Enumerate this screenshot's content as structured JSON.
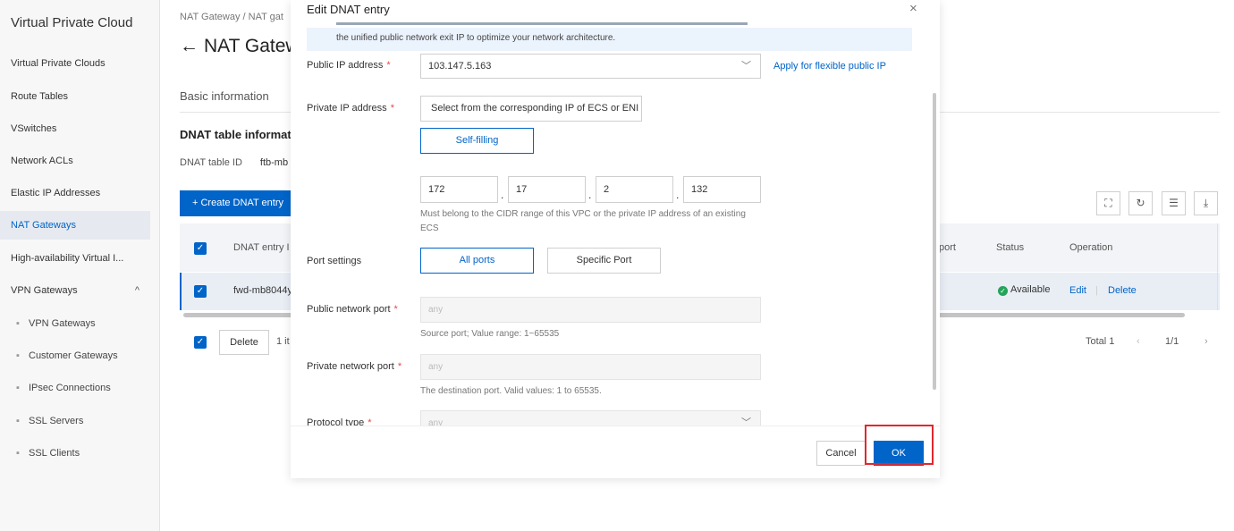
{
  "sidebar": {
    "title": "Virtual Private Cloud",
    "items": [
      {
        "label": "Virtual Private Clouds",
        "active": false
      },
      {
        "label": "Route Tables",
        "active": false
      },
      {
        "label": "VSwitches",
        "active": false
      },
      {
        "label": "Network ACLs",
        "active": false
      },
      {
        "label": "Elastic IP Addresses",
        "active": false
      },
      {
        "label": "NAT Gateways",
        "active": true
      },
      {
        "label": "High-availability Virtual I...",
        "active": false
      },
      {
        "label": "VPN Gateways",
        "active": false,
        "expanded": true
      }
    ],
    "sub_items": [
      {
        "label": "VPN Gateways"
      },
      {
        "label": "Customer Gateways"
      },
      {
        "label": "IPsec Connections"
      },
      {
        "label": "SSL Servers"
      },
      {
        "label": "SSL Clients"
      }
    ],
    "sub_bullet": "▪",
    "expand_glyph": "^"
  },
  "page": {
    "breadcrumb": "NAT Gateway  /  NAT gat",
    "title_arrow": "←",
    "title": "NAT Gatew",
    "tab_basic": "Basic information",
    "section_title": "DNAT table informat",
    "dnat_table_id_label": "DNAT table ID",
    "dnat_table_id_value": "ftb-mb",
    "create_button": "+ Create DNAT entry",
    "tools": [
      {
        "icon": "fullscreen-icon",
        "glyph": "⛶"
      },
      {
        "icon": "refresh-icon",
        "glyph": "↻"
      },
      {
        "icon": "column-settings-icon",
        "glyph": "☰"
      },
      {
        "icon": "download-icon",
        "glyph": "⤓"
      }
    ],
    "table": {
      "columns": {
        "entry": "DNAT entry I",
        "port": "port",
        "status": "Status",
        "operation": "Operation"
      },
      "rows": [
        {
          "entry": "fwd-mb8044y",
          "status": "Available",
          "edit": "Edit",
          "separator": "|",
          "delete": "Delete",
          "selected": true
        }
      ]
    },
    "bulk_delete": "Delete",
    "selected_count": "1 it",
    "pagination": {
      "total": "Total 1",
      "prev": "‹",
      "page": "1/1",
      "next": "›"
    }
  },
  "modal": {
    "title": "Edit DNAT entry",
    "close": "×",
    "notice_text": "the unified public network exit IP to optimize your network architecture.",
    "public_ip": {
      "label": "Public IP address",
      "value": "103.147.5.163",
      "apply_link": "Apply for flexible public IP"
    },
    "private_ip": {
      "label": "Private IP address",
      "option_select": "Select from the corresponding IP of ECS or ENI",
      "option_self": "Self-filling",
      "segments": [
        "172",
        "17",
        "2",
        "132"
      ],
      "separator": ".",
      "hint": "Must belong to the CIDR range of this VPC or the private IP address of an existing ECS"
    },
    "port_settings": {
      "label": "Port settings",
      "all": "All ports",
      "specific": "Specific Port"
    },
    "public_port": {
      "label": "Public network port",
      "placeholder": "any",
      "hint": "Source port; Value range: 1~65535"
    },
    "private_port": {
      "label": "Private network port",
      "placeholder": "any",
      "hint": "The destination port. Valid values: 1 to 65535."
    },
    "protocol": {
      "label": "Protocol type",
      "placeholder": "any"
    },
    "required_mark": "*",
    "cancel": "Cancel",
    "ok": "OK"
  },
  "colors": {
    "accent": "#0064c8",
    "highlight": "#e0282e",
    "available": "#23a45a"
  }
}
